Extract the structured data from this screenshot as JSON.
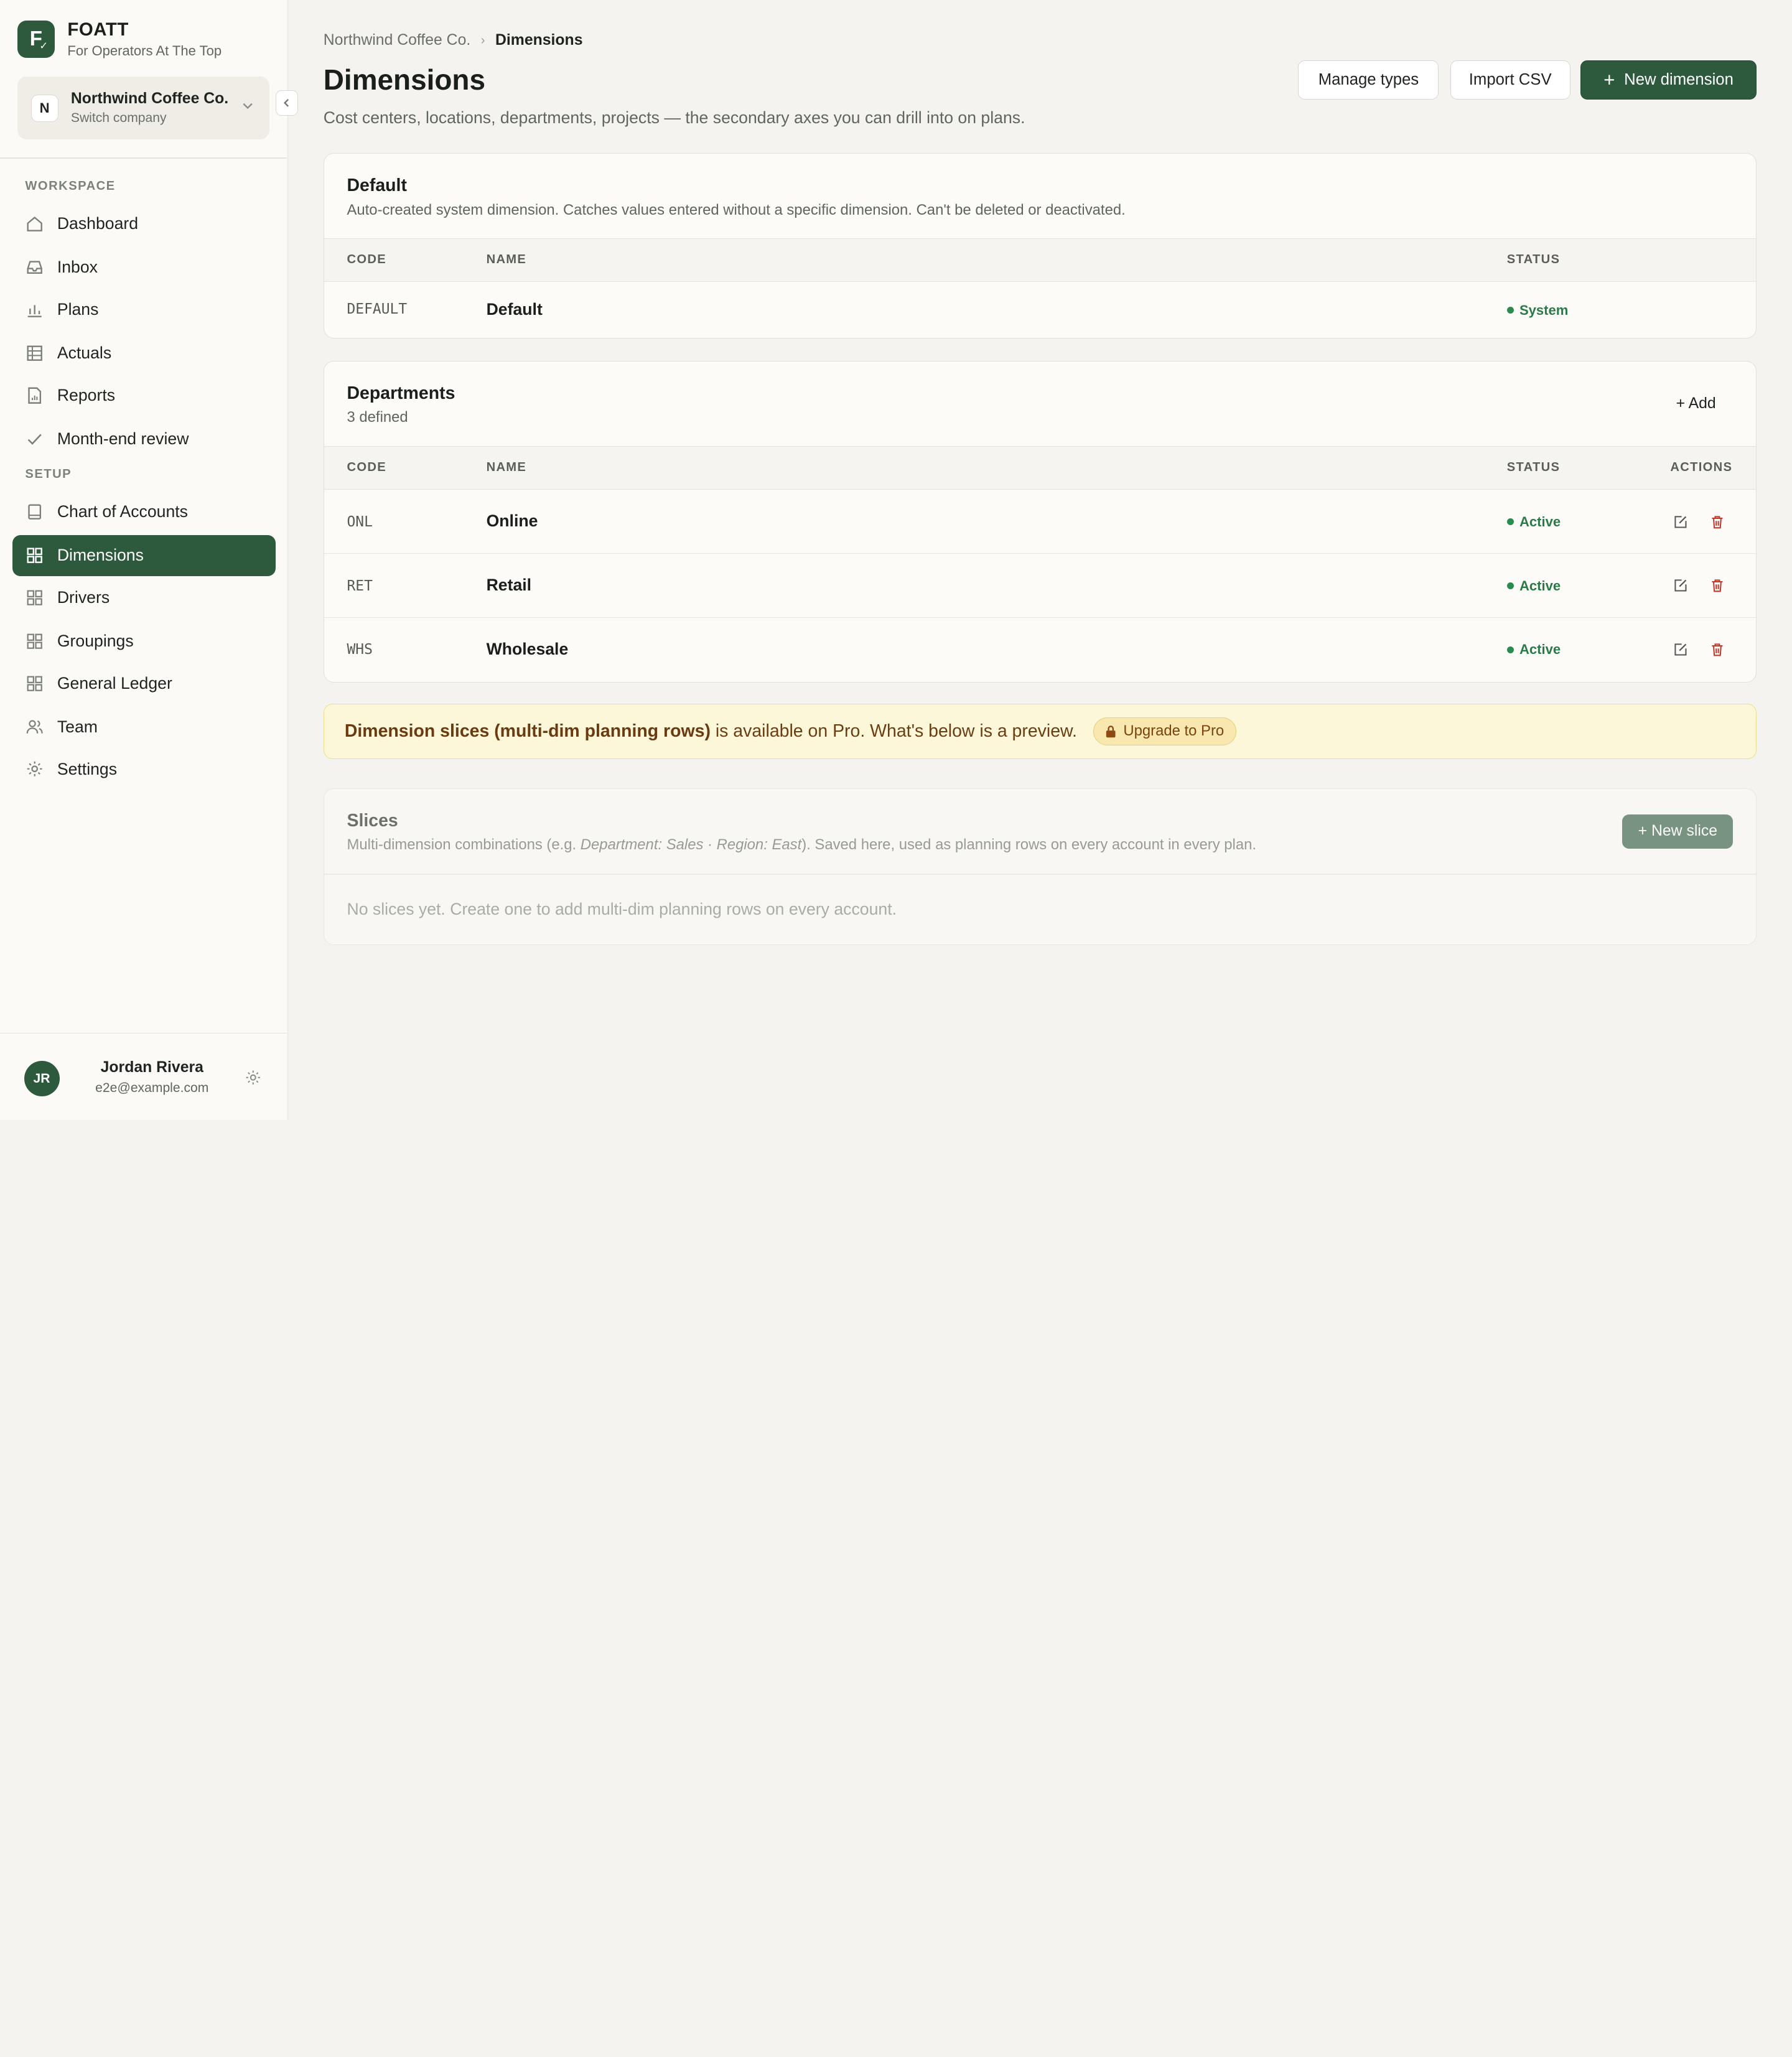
{
  "brand": {
    "logo_letter": "F",
    "name": "FOATT",
    "tagline": "For Operators At The Top"
  },
  "company": {
    "badge": "N",
    "name": "Northwind Coffee Co.",
    "sub": "Switch company"
  },
  "sidebar": {
    "workspace_label": "WORKSPACE",
    "setup_label": "SETUP",
    "workspace_items": [
      {
        "label": "Dashboard",
        "icon": "home-icon"
      },
      {
        "label": "Inbox",
        "icon": "inbox-icon"
      },
      {
        "label": "Plans",
        "icon": "bar-chart-icon"
      },
      {
        "label": "Actuals",
        "icon": "table-icon"
      },
      {
        "label": "Reports",
        "icon": "report-icon"
      },
      {
        "label": "Month-end review",
        "icon": "check-icon"
      }
    ],
    "setup_items": [
      {
        "label": "Chart of Accounts",
        "icon": "book-icon"
      },
      {
        "label": "Dimensions",
        "icon": "grid-icon",
        "active": true
      },
      {
        "label": "Drivers",
        "icon": "grid-icon"
      },
      {
        "label": "Groupings",
        "icon": "grid-icon"
      },
      {
        "label": "General Ledger",
        "icon": "grid-icon"
      },
      {
        "label": "Team",
        "icon": "users-icon"
      },
      {
        "label": "Settings",
        "icon": "gear-icon"
      }
    ]
  },
  "user": {
    "initials": "JR",
    "name": "Jordan Rivera",
    "email": "e2e@example.com"
  },
  "header": {
    "breadcrumb": [
      "Northwind Coffee Co.",
      "Dimensions"
    ],
    "title": "Dimensions",
    "subtitle": "Cost centers, locations, departments, projects — the secondary axes you can drill into on plans.",
    "buttons": {
      "manage_types": "Manage types",
      "import_csv": "Import CSV",
      "new_dimension": "New dimension"
    }
  },
  "default_card": {
    "title": "Default",
    "subtitle": "Auto-created system dimension. Catches values entered without a specific dimension. Can't be deleted or deactivated.",
    "columns": {
      "code": "CODE",
      "name": "NAME",
      "status": "STATUS"
    },
    "rows": [
      {
        "code": "DEFAULT",
        "name": "Default",
        "status": "System"
      }
    ]
  },
  "departments_card": {
    "title": "Departments",
    "subtitle": "3 defined",
    "add_label": "+ Add",
    "columns": {
      "code": "CODE",
      "name": "NAME",
      "status": "STATUS",
      "actions": "ACTIONS"
    },
    "rows": [
      {
        "code": "ONL",
        "name": "Online",
        "status": "Active"
      },
      {
        "code": "RET",
        "name": "Retail",
        "status": "Active"
      },
      {
        "code": "WHS",
        "name": "Wholesale",
        "status": "Active"
      }
    ]
  },
  "banner": {
    "strong": "Dimension slices (multi-dim planning rows)",
    "text": " is available on Pro. What's below is a preview.",
    "pill": "Upgrade to Pro"
  },
  "slices_card": {
    "title": "Slices",
    "subtitle_pre": "Multi-dimension combinations (e.g. ",
    "subtitle_example": "Department: Sales · Region: East",
    "subtitle_post": "). Saved here, used as planning rows on every account in every plan.",
    "new_slice": "+ New slice",
    "empty": "No slices yet. Create one to add multi-dim planning rows on every account."
  },
  "colors": {
    "accent": "#2d5a3d",
    "status_green": "#2b7a49",
    "banner_bg": "#fdf7d9",
    "danger": "#c0392b"
  }
}
